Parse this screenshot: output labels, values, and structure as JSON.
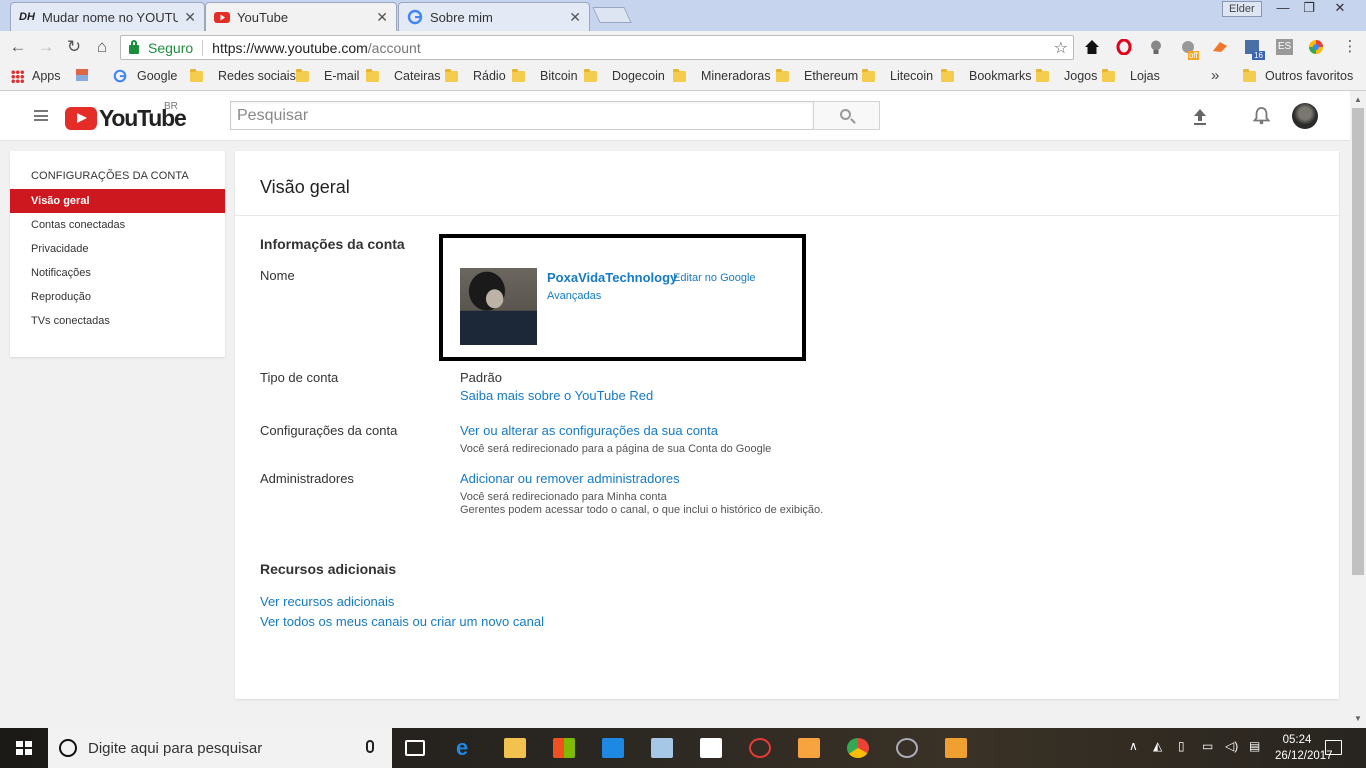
{
  "browser": {
    "tabs": [
      {
        "title": "Mudar nome no YOUTUBE",
        "icon": "dh-favicon",
        "active": false
      },
      {
        "title": "YouTube",
        "icon": "youtube-favicon",
        "active": true
      },
      {
        "title": "Sobre mim",
        "icon": "google-favicon",
        "active": false
      }
    ],
    "window_user": "Elder",
    "security_label": "Seguro",
    "url_host": "https://www.youtube.com",
    "url_path": "/account",
    "bookmarks": [
      {
        "label": "Apps",
        "type": "apps"
      },
      {
        "label": "",
        "type": "image"
      },
      {
        "label": "Google",
        "type": "google"
      },
      {
        "label": "Redes sociais",
        "type": "folder"
      },
      {
        "label": "E-mail",
        "type": "folder"
      },
      {
        "label": "Cateiras",
        "type": "folder"
      },
      {
        "label": "Rádio",
        "type": "folder"
      },
      {
        "label": "Bitcoin",
        "type": "folder"
      },
      {
        "label": "Dogecoin",
        "type": "folder"
      },
      {
        "label": "Mineradoras",
        "type": "folder"
      },
      {
        "label": "Ethereum",
        "type": "folder"
      },
      {
        "label": "Litecoin",
        "type": "folder"
      },
      {
        "label": "Bookmarks",
        "type": "folder"
      },
      {
        "label": "Jogos",
        "type": "folder"
      },
      {
        "label": "Lojas",
        "type": "folder"
      }
    ],
    "other_bookmarks": "Outros favoritos",
    "more_symbol": "»",
    "extension_badges": {
      "off": "off",
      "count": "16",
      "es": "ES"
    }
  },
  "youtube": {
    "logo_text": "YouTube",
    "country_code": "BR",
    "search_placeholder": "Pesquisar",
    "accent_color": "#cc181e"
  },
  "sidebar": {
    "heading": "CONFIGURAÇÕES DA CONTA",
    "items": [
      {
        "label": "Visão geral",
        "active": true
      },
      {
        "label": "Contas conectadas",
        "active": false
      },
      {
        "label": "Privacidade",
        "active": false
      },
      {
        "label": "Notificações",
        "active": false
      },
      {
        "label": "Reprodução",
        "active": false
      },
      {
        "label": "TVs conectadas",
        "active": false
      }
    ]
  },
  "main": {
    "title": "Visão geral",
    "account_info_heading": "Informações da conta",
    "name_label": "Nome",
    "channel_name": "PoxaVidaTechnology",
    "edit_google": "Editar no Google",
    "advanced": "Avançadas",
    "account_type_label": "Tipo de conta",
    "account_type_value": "Padrão",
    "youtube_red_link": "Saiba mais sobre o YouTube Red",
    "account_settings_label": "Configurações da conta",
    "account_settings_link": "Ver ou alterar as configurações da sua conta",
    "account_settings_note": "Você será redirecionado para a página de sua Conta do Google",
    "admins_label": "Administradores",
    "admins_link": "Adicionar ou remover administradores",
    "admins_note1": "Você será redirecionado para Minha conta",
    "admins_note2": "Gerentes podem acessar todo o canal, o que inclui o histórico de exibição.",
    "extra_heading": "Recursos adicionais",
    "extra_link1": "Ver recursos adicionais",
    "extra_link2": "Ver todos os meus canais ou criar um novo canal"
  },
  "taskbar": {
    "search_placeholder": "Digite aqui para pesquisar",
    "time": "05:24",
    "date": "26/12/2017"
  }
}
